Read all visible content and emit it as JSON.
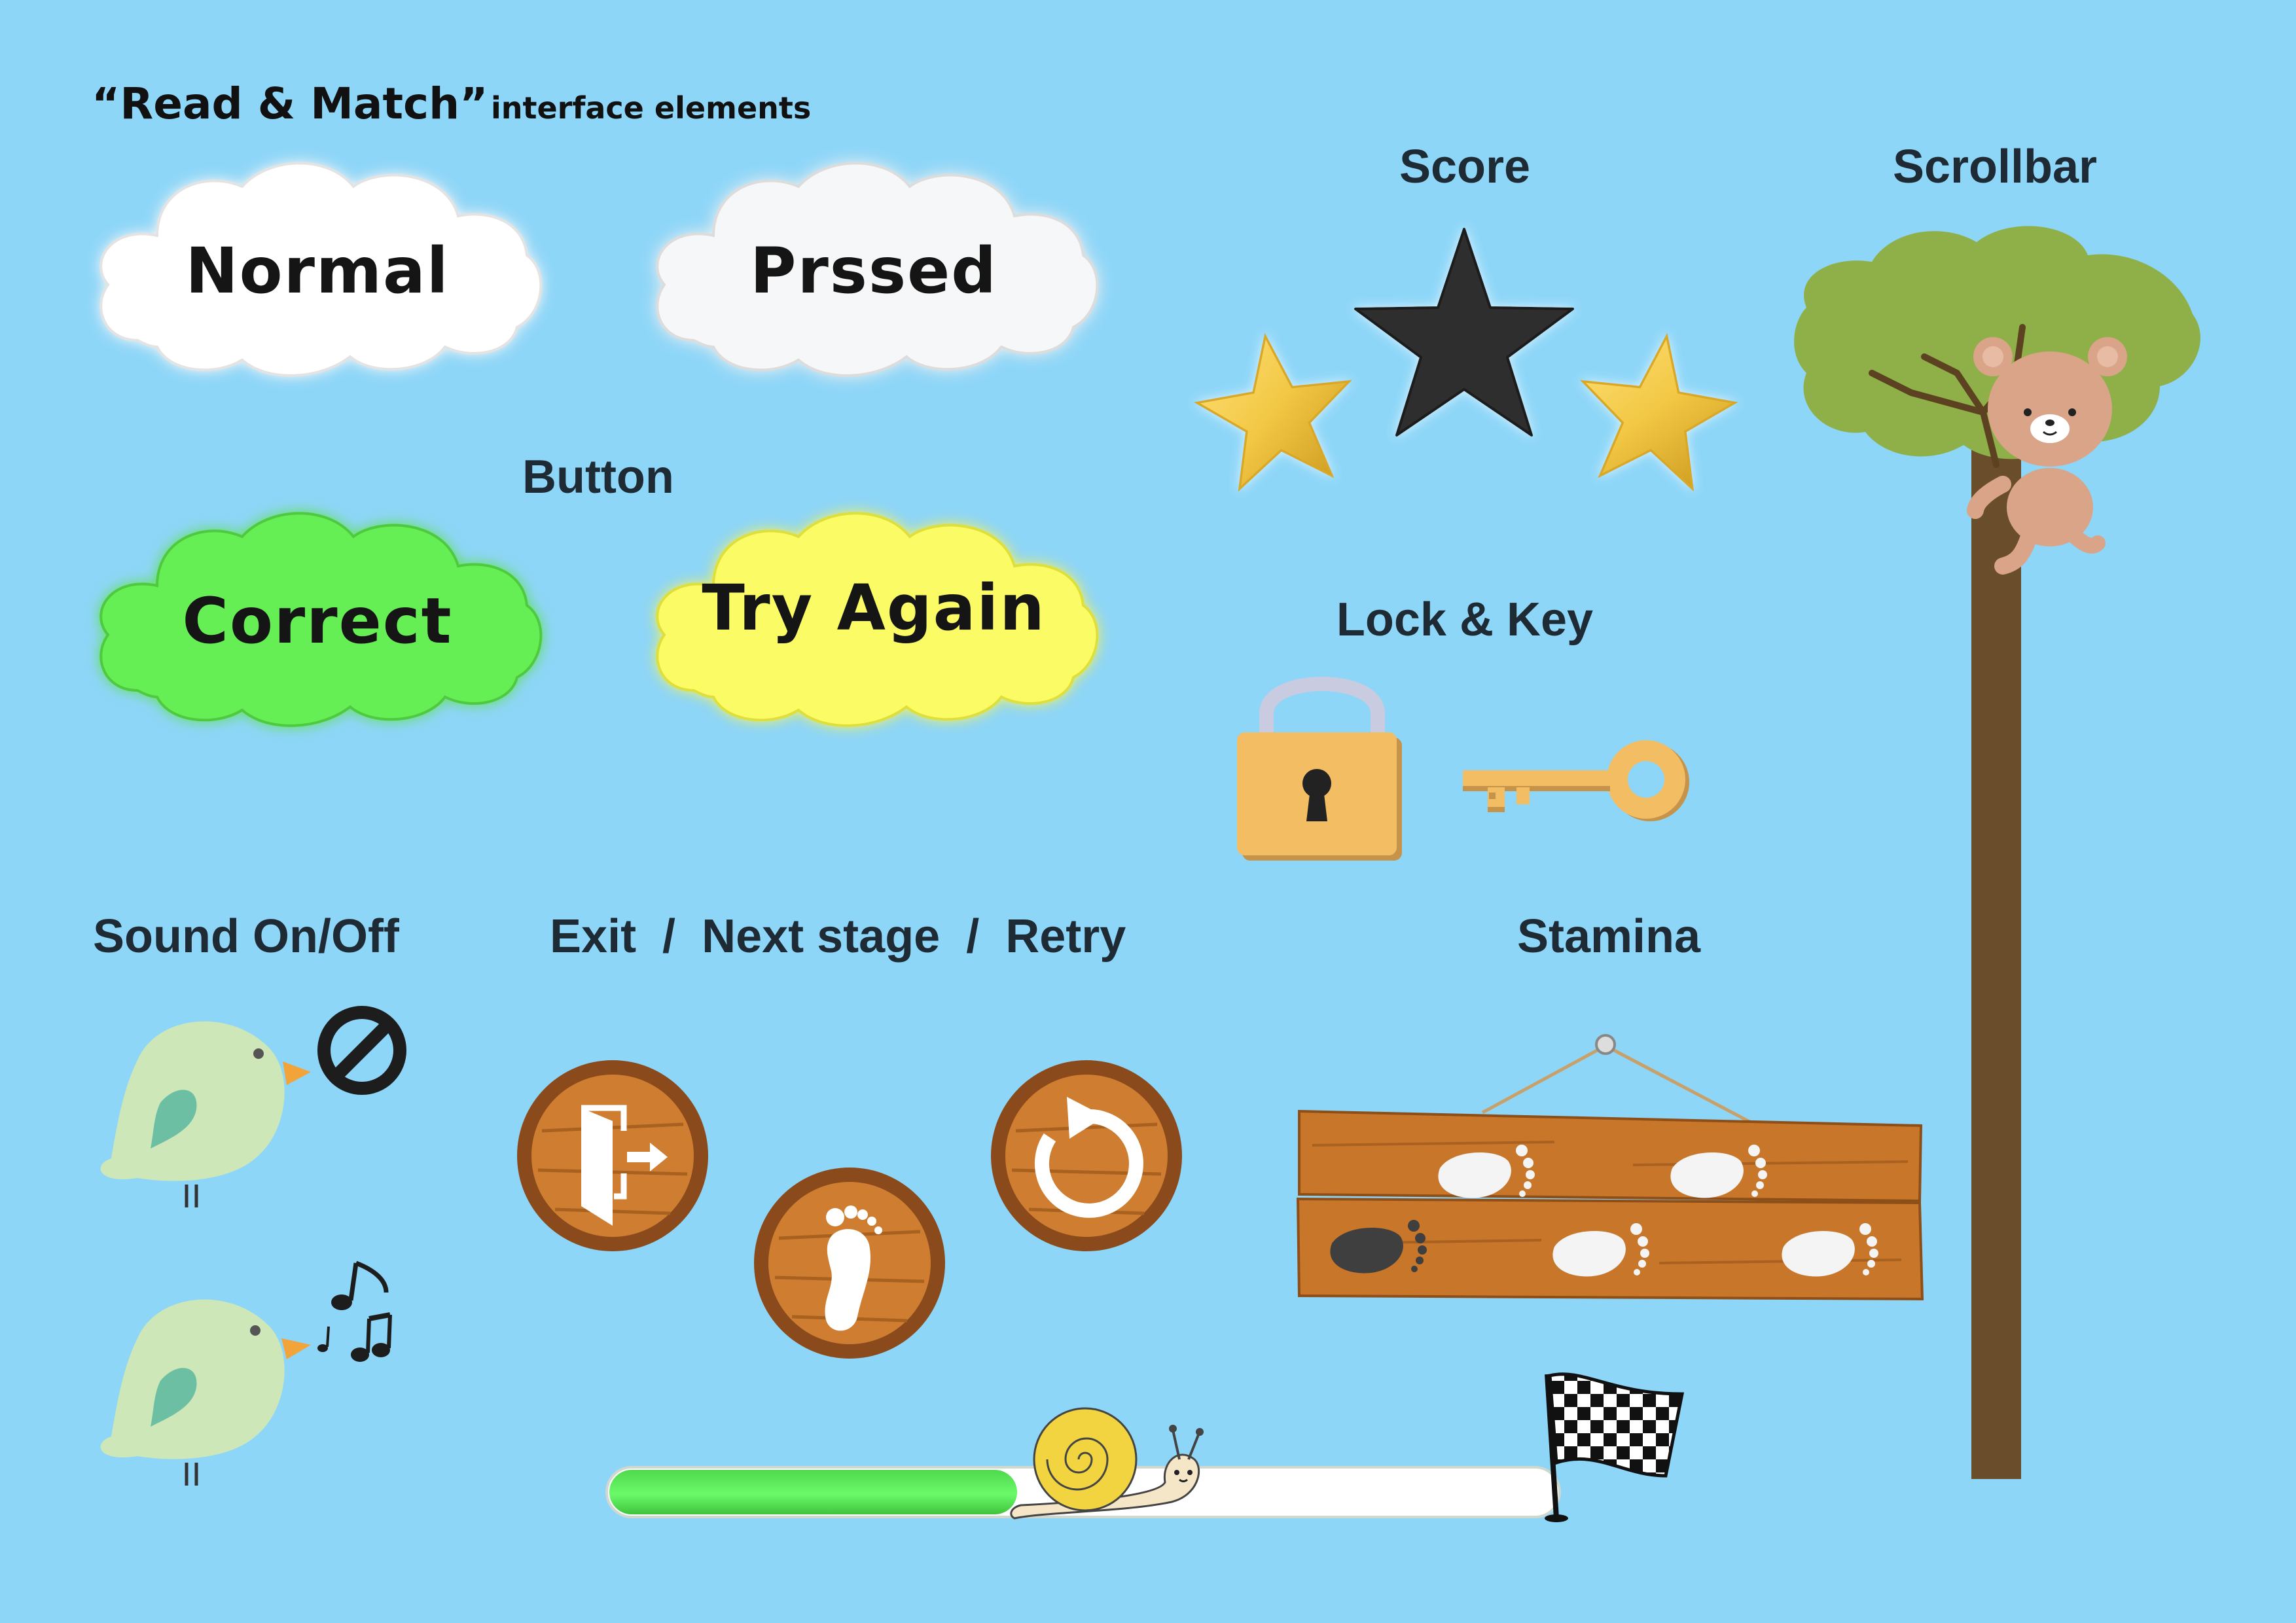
{
  "title": {
    "main": "“Read & Match”",
    "sub": "interface elements"
  },
  "button_section": {
    "label": "Button",
    "normal_label": "Normal",
    "pressed_label": "Prssed",
    "correct_label": "Correct",
    "try_again_label": "Try Again"
  },
  "score": {
    "label": "Score",
    "stars": [
      "gold-star-icon",
      "dark-star-icon",
      "gold-star-icon"
    ]
  },
  "scrollbar": {
    "label": "Scrollbar"
  },
  "lock_key": {
    "label": "Lock & Key"
  },
  "sound": {
    "label": "Sound On/Off"
  },
  "navigation": {
    "label": "Exit  /  Next stage  /  Retry"
  },
  "stamina": {
    "label": "Stamina",
    "filled": 1,
    "total": 5
  },
  "progress": {
    "value": 0.43
  },
  "colors": {
    "background": "#8ed6f8",
    "correct": "#66ee55",
    "try_again": "#fbfb66",
    "wood": "#c8762a",
    "gold": "#f2c744",
    "progress_fill": "#5ef25b"
  }
}
